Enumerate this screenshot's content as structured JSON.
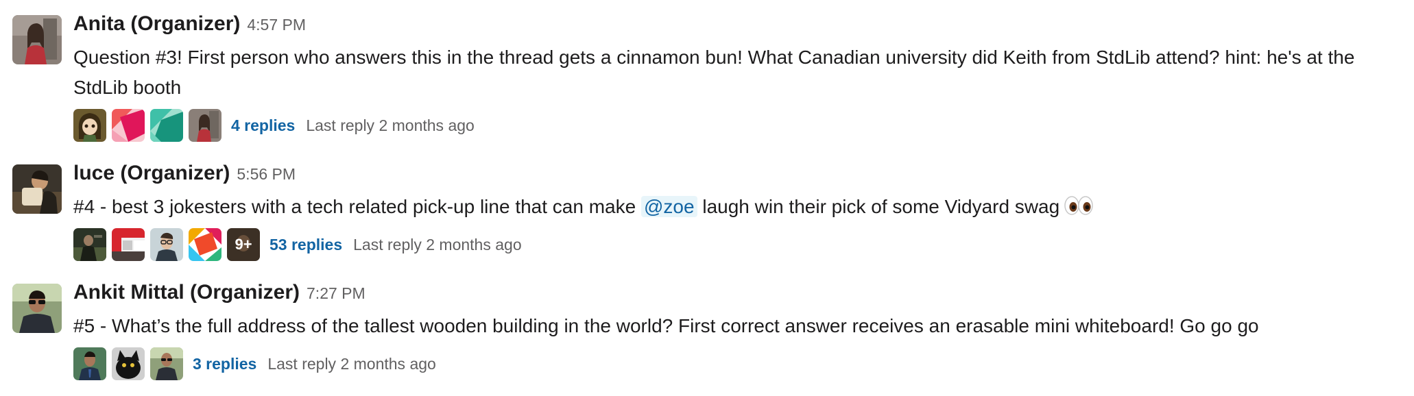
{
  "messages": [
    {
      "author": "Anita (Organizer)",
      "time": "4:57 PM",
      "text": "Question #3! First person who answers this in the thread gets a cinnamon bun! What Canadian university did Keith from StdLib attend? hint: he's at the StdLib booth",
      "thread": {
        "replies": "4 replies",
        "last_reply": "Last reply 2 months ago",
        "participants": [
          "anime-girl-avatar",
          "red-pink-default-avatar",
          "teal-default-avatar",
          "anita-avatar"
        ]
      }
    },
    {
      "author": "luce (Organizer)",
      "time": "5:56 PM",
      "text_before": "#4 - best 3 jokesters with a tech related pick-up line that can make ",
      "mention": "@zoe",
      "text_after": " laugh win their pick of some Vidyard swag",
      "emoji": "eyes-emoji",
      "thread": {
        "replies": "53 replies",
        "last_reply": "Last reply 2 months ago",
        "more_count": "9+",
        "participants": [
          "dark-photo-avatar",
          "red-grid-default-avatar",
          "glasses-man-avatar",
          "multicolor-default-avatar",
          "brown-avatar"
        ]
      }
    },
    {
      "author": "Ankit Mittal (Organizer)",
      "time": "7:27 PM",
      "text": "#5 - What’s the full address of the tallest wooden building in the world? First correct answer receives an erasable mini whiteboard! Go go go",
      "thread": {
        "replies": "3 replies",
        "last_reply": "Last reply 2 months ago",
        "participants": [
          "ankit-suit-avatar",
          "black-cat-avatar",
          "ankit-sunglasses-avatar"
        ]
      }
    }
  ],
  "colors": {
    "link": "#1264a3",
    "muted": "#616061",
    "text": "#1d1c1d"
  }
}
